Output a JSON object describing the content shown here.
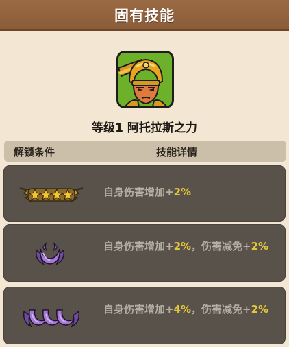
{
  "header": {
    "title": "固有技能"
  },
  "skill": {
    "level_name": "等级1 阿托拉斯之力",
    "portrait_icon": "golden-helmet-hero-icon"
  },
  "columns": {
    "unlock": "解锁条件",
    "detail": "技能详情"
  },
  "rows": [
    {
      "badge_icon": "four-gold-stars-winged-badge-icon",
      "desc_prefix": "自身伤害增加+",
      "desc_value": "2%",
      "desc_mid": "",
      "desc_value2": ""
    },
    {
      "badge_icon": "purple-crescent-badge-icon",
      "desc_prefix": "自身伤害增加+",
      "desc_value": "2%",
      "desc_mid": "，伤害减免+",
      "desc_value2": "2%"
    },
    {
      "badge_icon": "three-purple-crescents-badge-icon",
      "desc_prefix": "自身伤害增加+",
      "desc_value": "4%",
      "desc_mid": "，伤害减免+",
      "desc_value2": "2%"
    }
  ],
  "colors": {
    "header_bg": "#9a6a44",
    "panel_bg": "#f3e7d3",
    "row_bg": "#58524b",
    "value_color": "#e2c53d",
    "text_gray": "#b6aea2"
  }
}
